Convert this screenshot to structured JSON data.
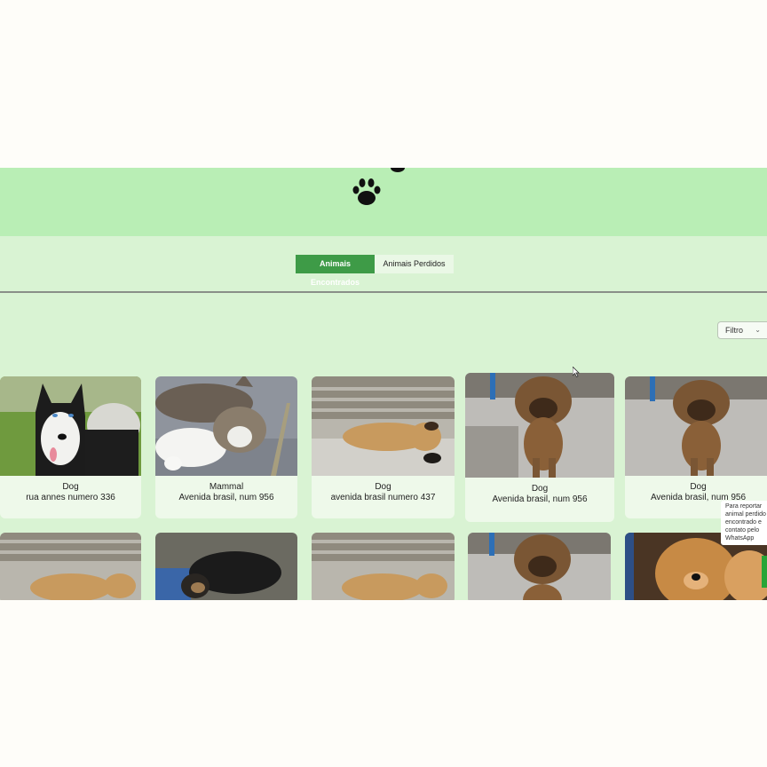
{
  "tabs": {
    "found_label": "Animais Encontrados",
    "lost_label": "Animais Perdidos"
  },
  "filter": {
    "label": "Filtro"
  },
  "cards": [
    {
      "species": "Dog",
      "address": "rua annes numero 336",
      "image": "husky-dog"
    },
    {
      "species": "Mammal",
      "address": "Avenida brasil, num 956",
      "image": "tabby-cat"
    },
    {
      "species": "Dog",
      "address": "avenida brasil numero 437",
      "image": "sleeping-dog-on-steps"
    },
    {
      "species": "Dog",
      "address": "Avenida brasil, num 956",
      "image": "brown-puppy"
    },
    {
      "species": "Dog",
      "address": "Avenida brasil, num 956",
      "image": "brown-puppy"
    },
    {
      "image": "sleeping-dog-on-steps"
    },
    {
      "image": "black-dog"
    },
    {
      "image": "sleeping-dog-on-steps"
    },
    {
      "image": "brown-puppy"
    },
    {
      "image": "chow-chow-dog"
    }
  ],
  "whatsapp_tooltip": "Para reportar animal perdido encontrado e contato pelo WhatsApp",
  "colors": {
    "header": "#b9eeb5",
    "page": "#d9f3d3",
    "accent": "#3e9b47"
  }
}
